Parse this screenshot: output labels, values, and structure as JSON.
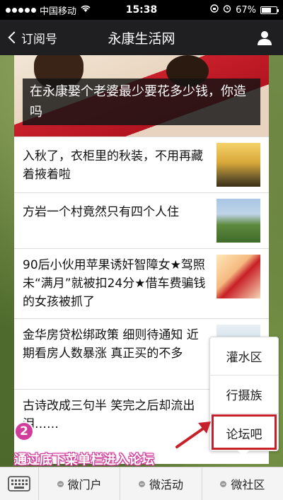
{
  "status_bar": {
    "carrier": "中国移动",
    "time": "15:38",
    "battery_text": "67%",
    "battery_level": 0.67
  },
  "nav": {
    "back_label": "订阅号",
    "title": "永康生活网"
  },
  "hero": {
    "caption": "在永康娶个老婆最少要花多少钱，你造吗"
  },
  "articles": [
    {
      "title": "入秋了，衣柜里的秋装，不用再藏着掖着啦",
      "thumb": "ginkgo-tree-photo"
    },
    {
      "title": "方岩一个村竟然只有四个人住",
      "thumb": "village-photo"
    },
    {
      "title": "90后小伙用苹果诱奸智障女★驾照未“满月”就被扣24分★借车费骗钱的女孩被抓了",
      "thumb": "comic-photo"
    },
    {
      "title": "金华房贷松绑政策 细则待通知 近期看房人数暴涨 真正买的不多",
      "thumb": "house-photo"
    },
    {
      "title": "古诗改成三句半 笑完之后却流出泪……",
      "thumb": ""
    }
  ],
  "popup_menu": {
    "items": [
      "灌水区",
      "行摄族",
      "论坛吧"
    ],
    "highlight_color": "#c8202b"
  },
  "annotation": {
    "step": "2",
    "instruction": "通过底下菜单栏进入论坛",
    "accent_color": "#d23c9a"
  },
  "bottom_menu": {
    "keyboard_icon": "keyboard-icon",
    "tabs": [
      "微门户",
      "微活动",
      "微社区"
    ]
  }
}
